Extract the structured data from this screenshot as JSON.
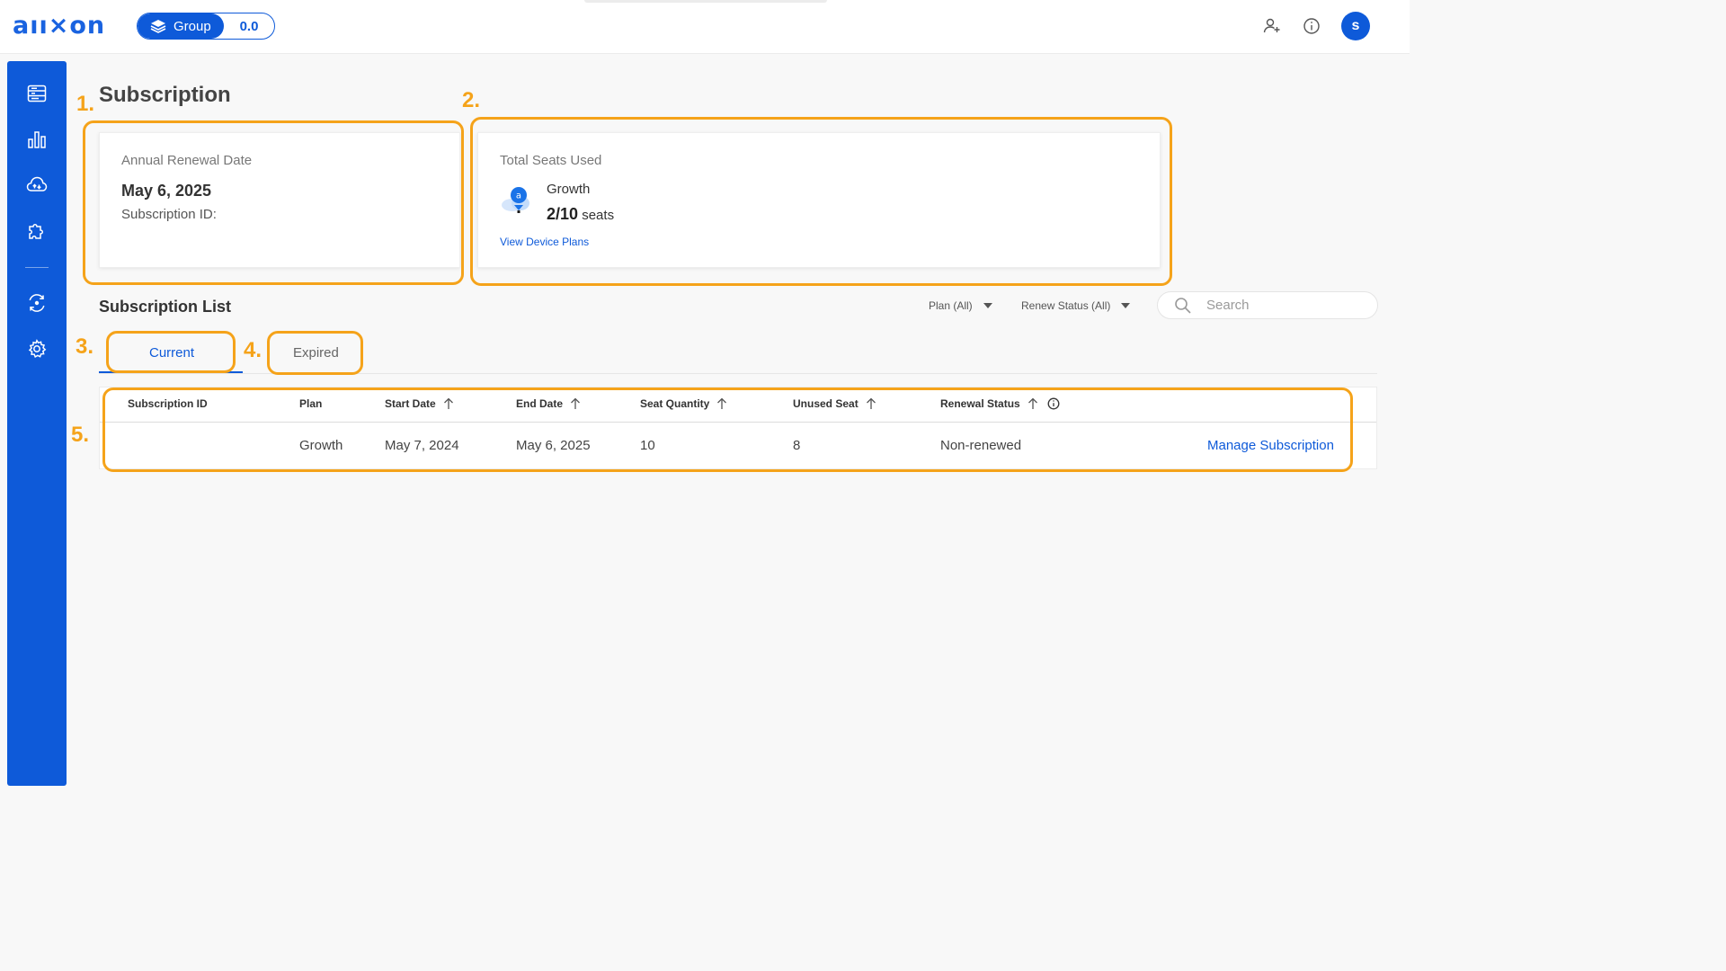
{
  "header": {
    "logo": "aıı×on",
    "group_label": "Group",
    "group_value": "0.0",
    "avatar_letter": "s"
  },
  "page": {
    "title": "Subscription"
  },
  "renewal_card": {
    "label": "Annual Renewal Date",
    "date": "May 6, 2025",
    "subscription_id_label": "Subscription ID:"
  },
  "seats_card": {
    "label": "Total Seats Used",
    "plan": "Growth",
    "seats_used": "2/10",
    "seats_unit": "seats",
    "link": "View Device Plans"
  },
  "list": {
    "title": "Subscription List",
    "filters": {
      "plan": "Plan (All)",
      "renew_status": "Renew Status (All)"
    },
    "search_placeholder": "Search",
    "tabs": [
      {
        "label": "Current",
        "active": true
      },
      {
        "label": "Expired",
        "active": false
      }
    ],
    "columns": [
      "Subscription ID",
      "Plan",
      "Start Date",
      "End Date",
      "Seat Quantity",
      "Unused Seat",
      "Renewal Status"
    ],
    "rows": [
      {
        "subscription_id": "",
        "plan": "Growth",
        "start_date": "May 7, 2024",
        "end_date": "May 6, 2025",
        "seat_quantity": "10",
        "unused_seat": "8",
        "renewal_status": "Non-renewed",
        "action": "Manage Subscription"
      }
    ]
  },
  "annotations": [
    "1.",
    "2.",
    "3.",
    "4.",
    "5."
  ],
  "colors": {
    "brand": "#0e5ad9",
    "highlight": "#f5a31a"
  }
}
